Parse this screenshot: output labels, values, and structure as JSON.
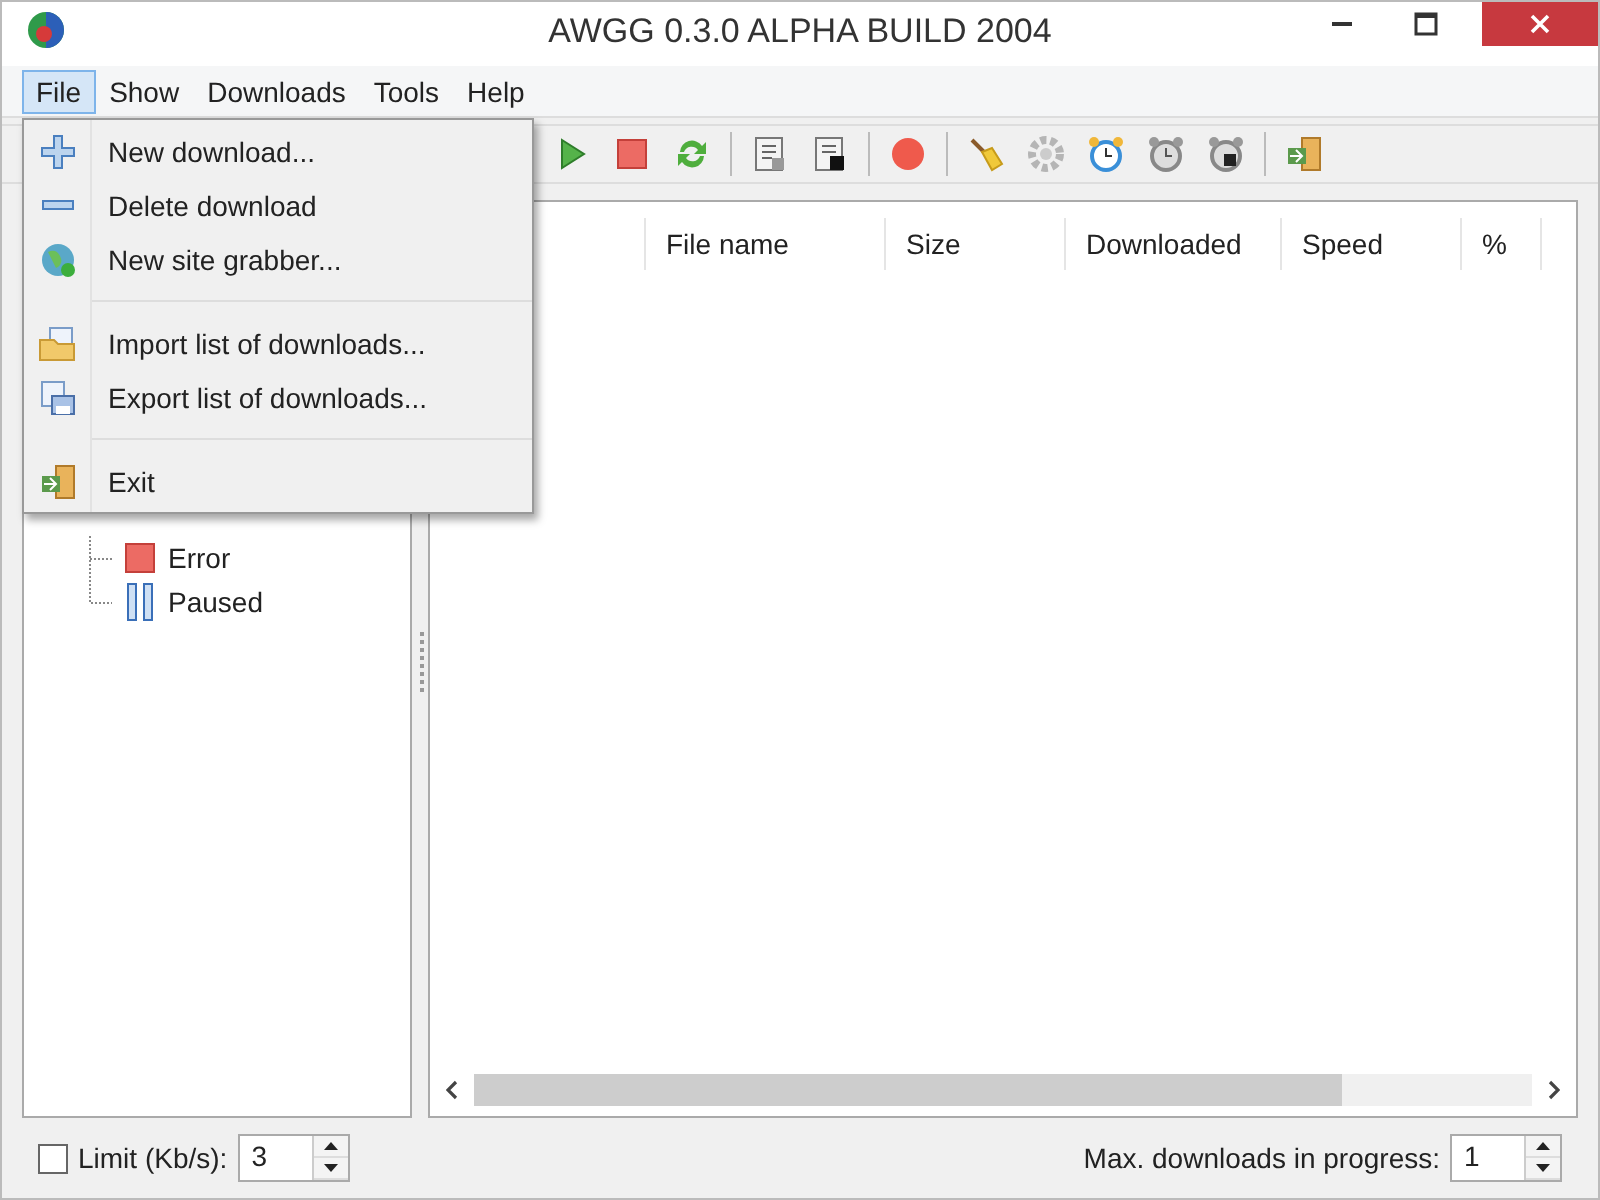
{
  "window": {
    "title": "AWGG 0.3.0 ALPHA BUILD 2004"
  },
  "menu_bar": [
    {
      "label": "File",
      "selected": true
    },
    {
      "label": "Show",
      "selected": false
    },
    {
      "label": "Downloads",
      "selected": false
    },
    {
      "label": "Tools",
      "selected": false
    },
    {
      "label": "Help",
      "selected": false
    }
  ],
  "file_menu": [
    {
      "kind": "item",
      "label": "New download..."
    },
    {
      "kind": "item",
      "label": "Delete download"
    },
    {
      "kind": "item",
      "label": "New site grabber..."
    },
    {
      "kind": "separator"
    },
    {
      "kind": "item",
      "label": "Import list of downloads..."
    },
    {
      "kind": "item",
      "label": "Export list of downloads..."
    },
    {
      "kind": "separator"
    },
    {
      "kind": "item",
      "label": "Exit"
    }
  ],
  "tree": [
    {
      "kind": "error",
      "label": "Error"
    },
    {
      "kind": "paused",
      "label": "Paused"
    }
  ],
  "table": {
    "columns": [
      "File name",
      "Size",
      "Downloaded",
      "Speed",
      "%"
    ]
  },
  "bottom_bar": {
    "limit": {
      "label": "Limit (Kb/s):",
      "checked": false,
      "value": "3"
    },
    "max_downloads": {
      "label": "Max. downloads in progress:",
      "value": "1"
    }
  }
}
